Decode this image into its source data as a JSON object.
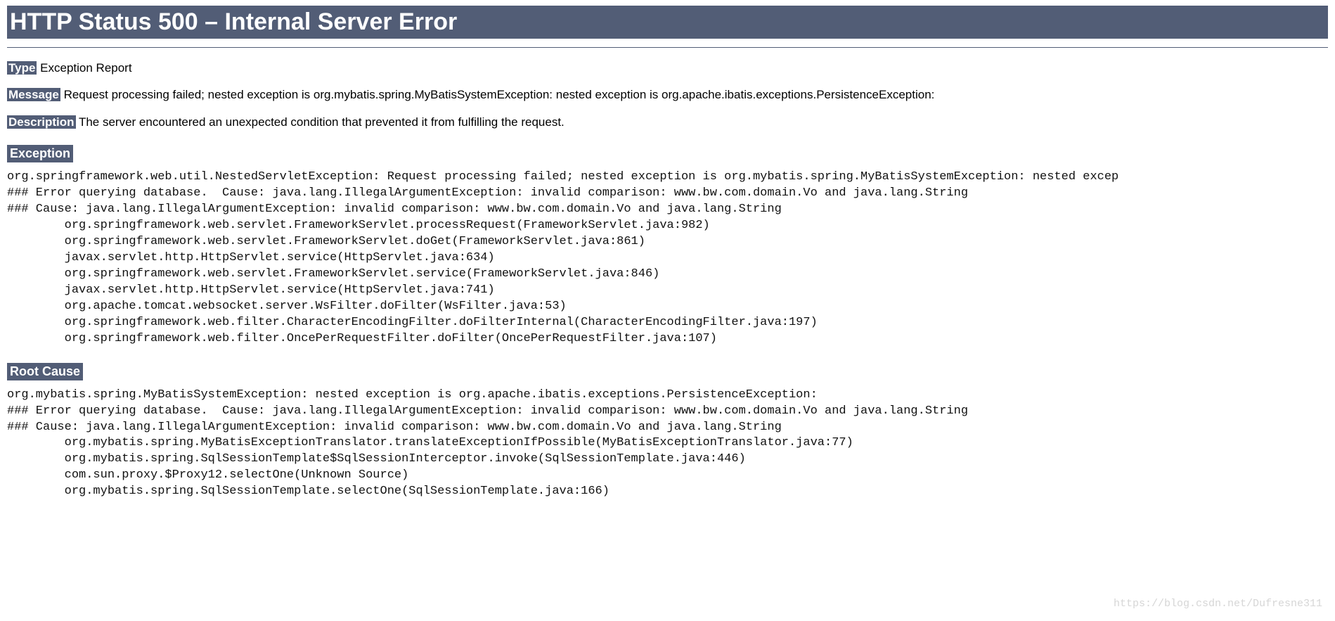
{
  "title": "HTTP Status 500 – Internal Server Error",
  "labels": {
    "type": "Type",
    "message": "Message",
    "description": "Description",
    "exception": "Exception",
    "root_cause": "Root Cause"
  },
  "values": {
    "type": "Exception Report",
    "message": "Request processing failed; nested exception is org.mybatis.spring.MyBatisSystemException: nested exception is org.apache.ibatis.exceptions.PersistenceException:",
    "description": "The server encountered an unexpected condition that prevented it from fulfilling the request."
  },
  "exception_trace": "org.springframework.web.util.NestedServletException: Request processing failed; nested exception is org.mybatis.spring.MyBatisSystemException: nested excep\n### Error querying database.  Cause: java.lang.IllegalArgumentException: invalid comparison: www.bw.com.domain.Vo and java.lang.String\n### Cause: java.lang.IllegalArgumentException: invalid comparison: www.bw.com.domain.Vo and java.lang.String\n        org.springframework.web.servlet.FrameworkServlet.processRequest(FrameworkServlet.java:982)\n        org.springframework.web.servlet.FrameworkServlet.doGet(FrameworkServlet.java:861)\n        javax.servlet.http.HttpServlet.service(HttpServlet.java:634)\n        org.springframework.web.servlet.FrameworkServlet.service(FrameworkServlet.java:846)\n        javax.servlet.http.HttpServlet.service(HttpServlet.java:741)\n        org.apache.tomcat.websocket.server.WsFilter.doFilter(WsFilter.java:53)\n        org.springframework.web.filter.CharacterEncodingFilter.doFilterInternal(CharacterEncodingFilter.java:197)\n        org.springframework.web.filter.OncePerRequestFilter.doFilter(OncePerRequestFilter.java:107)",
  "root_cause_trace": "org.mybatis.spring.MyBatisSystemException: nested exception is org.apache.ibatis.exceptions.PersistenceException: \n### Error querying database.  Cause: java.lang.IllegalArgumentException: invalid comparison: www.bw.com.domain.Vo and java.lang.String\n### Cause: java.lang.IllegalArgumentException: invalid comparison: www.bw.com.domain.Vo and java.lang.String\n        org.mybatis.spring.MyBatisExceptionTranslator.translateExceptionIfPossible(MyBatisExceptionTranslator.java:77)\n        org.mybatis.spring.SqlSessionTemplate$SqlSessionInterceptor.invoke(SqlSessionTemplate.java:446)\n        com.sun.proxy.$Proxy12.selectOne(Unknown Source)\n        org.mybatis.spring.SqlSessionTemplate.selectOne(SqlSessionTemplate.java:166)",
  "watermark": "https://blog.csdn.net/Dufresne311"
}
